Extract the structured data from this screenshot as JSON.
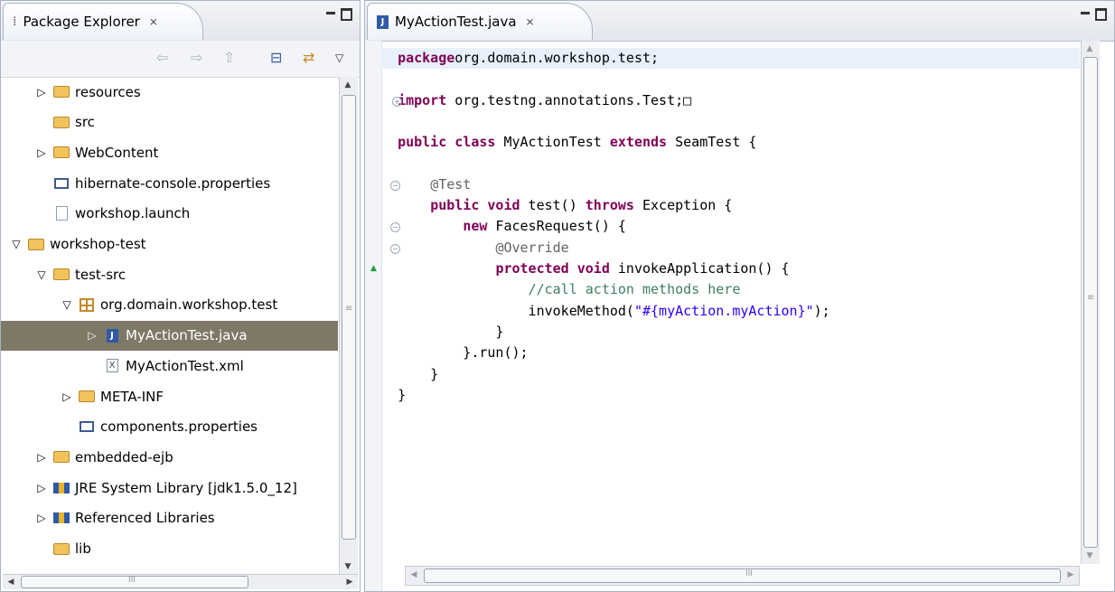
{
  "explorer": {
    "tab_label": "Package Explorer",
    "close_glyph": "⨯",
    "toolbar": {
      "back_icon": "back-arrow-icon",
      "forward_icon": "forward-arrow-icon",
      "up_icon": "up-icon",
      "collapse_icon": "collapse-all-icon",
      "link_icon": "link-with-editor-icon",
      "menu_icon": "view-menu-icon"
    },
    "tree": [
      {
        "label": "resources",
        "twisty": "▷",
        "icon": "folder",
        "indent": 1
      },
      {
        "label": "src",
        "twisty": "",
        "icon": "folder",
        "indent": 1
      },
      {
        "label": "WebContent",
        "twisty": "▷",
        "icon": "folder",
        "indent": 1
      },
      {
        "label": "hibernate-console.properties",
        "twisty": "",
        "icon": "props",
        "indent": 1
      },
      {
        "label": "workshop.launch",
        "twisty": "",
        "icon": "file",
        "indent": 1
      },
      {
        "label": "workshop-test",
        "twisty": "▽",
        "icon": "folder",
        "indent": 0
      },
      {
        "label": "test-src",
        "twisty": "▽",
        "icon": "folder",
        "indent": 1
      },
      {
        "label": "org.domain.workshop.test",
        "twisty": "▽",
        "icon": "pkg",
        "indent": 2
      },
      {
        "label": "MyActionTest.java",
        "twisty": "▷",
        "icon": "java",
        "indent": 3,
        "selected": true
      },
      {
        "label": "MyActionTest.xml",
        "twisty": "",
        "icon": "xml",
        "indent": 3
      },
      {
        "label": "META-INF",
        "twisty": "▷",
        "icon": "folder",
        "indent": 2
      },
      {
        "label": "components.properties",
        "twisty": "",
        "icon": "props",
        "indent": 2
      },
      {
        "label": "embedded-ejb",
        "twisty": "▷",
        "icon": "folder",
        "indent": 1
      },
      {
        "label": "JRE System Library [jdk1.5.0_12]",
        "twisty": "▷",
        "icon": "lib",
        "indent": 1
      },
      {
        "label": "Referenced Libraries",
        "twisty": "▷",
        "icon": "lib",
        "indent": 1
      },
      {
        "label": "lib",
        "twisty": "",
        "icon": "folder",
        "indent": 1
      }
    ]
  },
  "editor": {
    "tab_label": "MyActionTest.java",
    "close_glyph": "⨯",
    "code_lines": [
      {
        "row": 0,
        "current": true,
        "parts": [
          [
            "kw",
            "package"
          ],
          [
            "",
            "org.domain.workshop.test;"
          ]
        ]
      },
      {
        "row": 2,
        "marker": "plus",
        "parts": [
          [
            "kw",
            "import"
          ],
          [
            "",
            " org.testng.annotations.Test;"
          ],
          [
            "",
            "□"
          ]
        ]
      },
      {
        "row": 4,
        "parts": [
          [
            "kw",
            "public class"
          ],
          [
            "",
            " MyActionTest "
          ],
          [
            "kw",
            "extends"
          ],
          [
            "",
            " SeamTest {"
          ]
        ]
      },
      {
        "row": 6,
        "marker": "fold",
        "parts": [
          [
            "",
            "    "
          ],
          [
            "an",
            "@Test"
          ]
        ]
      },
      {
        "row": 7,
        "parts": [
          [
            "",
            "    "
          ],
          [
            "kw",
            "public void"
          ],
          [
            "",
            " test() "
          ],
          [
            "kw",
            "throws"
          ],
          [
            "",
            " Exception {"
          ]
        ]
      },
      {
        "row": 8,
        "marker": "fold",
        "parts": [
          [
            "",
            "        "
          ],
          [
            "kw",
            "new"
          ],
          [
            "",
            " FacesRequest() {"
          ]
        ]
      },
      {
        "row": 9,
        "marker": "fold",
        "parts": [
          [
            "",
            "            "
          ],
          [
            "an",
            "@Override"
          ]
        ]
      },
      {
        "row": 10,
        "marker": "override",
        "parts": [
          [
            "",
            "            "
          ],
          [
            "kw",
            "protected void"
          ],
          [
            "",
            " invokeApplication() {"
          ]
        ]
      },
      {
        "row": 11,
        "parts": [
          [
            "",
            "                "
          ],
          [
            "cm",
            "//call action methods here"
          ]
        ]
      },
      {
        "row": 12,
        "parts": [
          [
            "",
            "                invokeMethod("
          ],
          [
            "st",
            "\"#{myAction.myAction}\""
          ],
          [
            "",
            ");"
          ]
        ]
      },
      {
        "row": 13,
        "parts": [
          [
            "",
            "            }"
          ]
        ]
      },
      {
        "row": 14,
        "parts": [
          [
            "",
            "        }.run();"
          ]
        ]
      },
      {
        "row": 15,
        "parts": [
          [
            "",
            "    }"
          ]
        ]
      },
      {
        "row": 16,
        "parts": [
          [
            "",
            "}"
          ]
        ]
      }
    ],
    "scroll_grip": "≡",
    "hscroll_grip": "III"
  },
  "explorer_hscroll_grip": "III",
  "explorer_vscroll_grip": "≡",
  "colors": {
    "keyword": "#7f0055",
    "annotation": "#646464",
    "comment": "#3f7f5f",
    "string": "#2a00ff",
    "selection": "#7e7867"
  }
}
